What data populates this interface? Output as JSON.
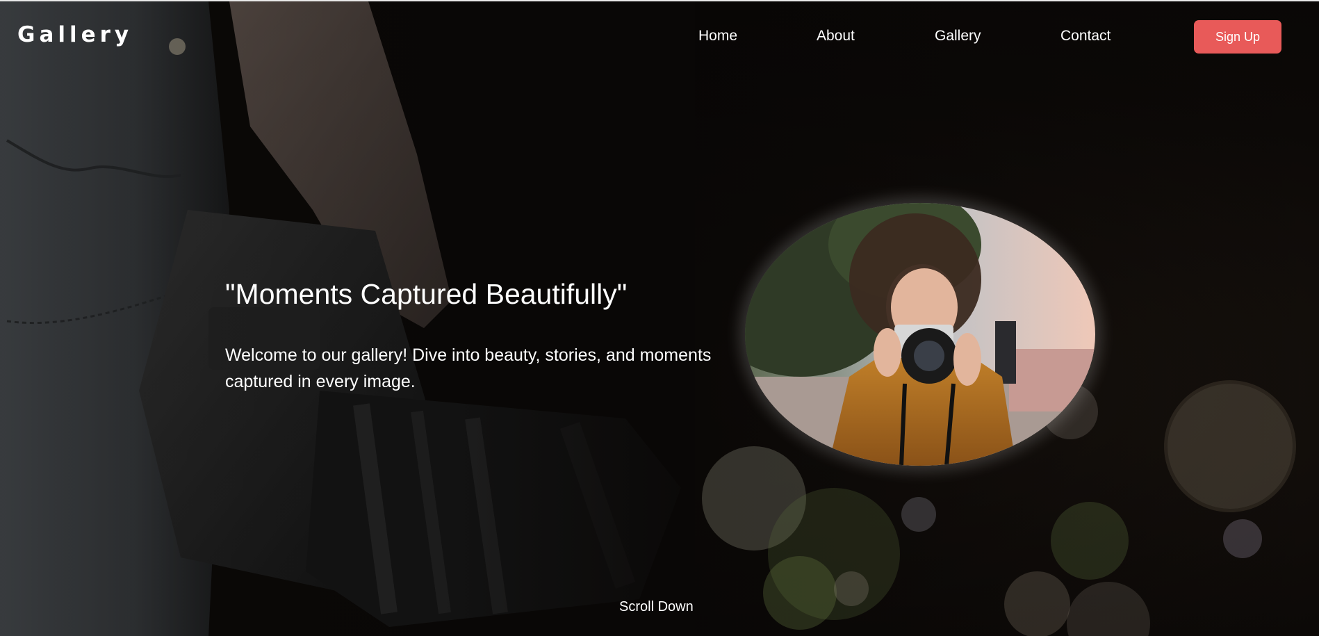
{
  "navbar": {
    "brand": "Gallery",
    "links": [
      {
        "label": "Home"
      },
      {
        "label": "About"
      },
      {
        "label": "Gallery"
      },
      {
        "label": "Contact"
      }
    ],
    "signup_label": "Sign Up"
  },
  "hero": {
    "title": "\"Moments Captured Beautifully\"",
    "subtitle": "Welcome to our gallery! Dive into beauty, stories, and moments captured in every image."
  },
  "scroll_label": "Scroll Down",
  "colors": {
    "accent": "#e85a59",
    "background": "#0c0907",
    "text": "#ffffff"
  }
}
